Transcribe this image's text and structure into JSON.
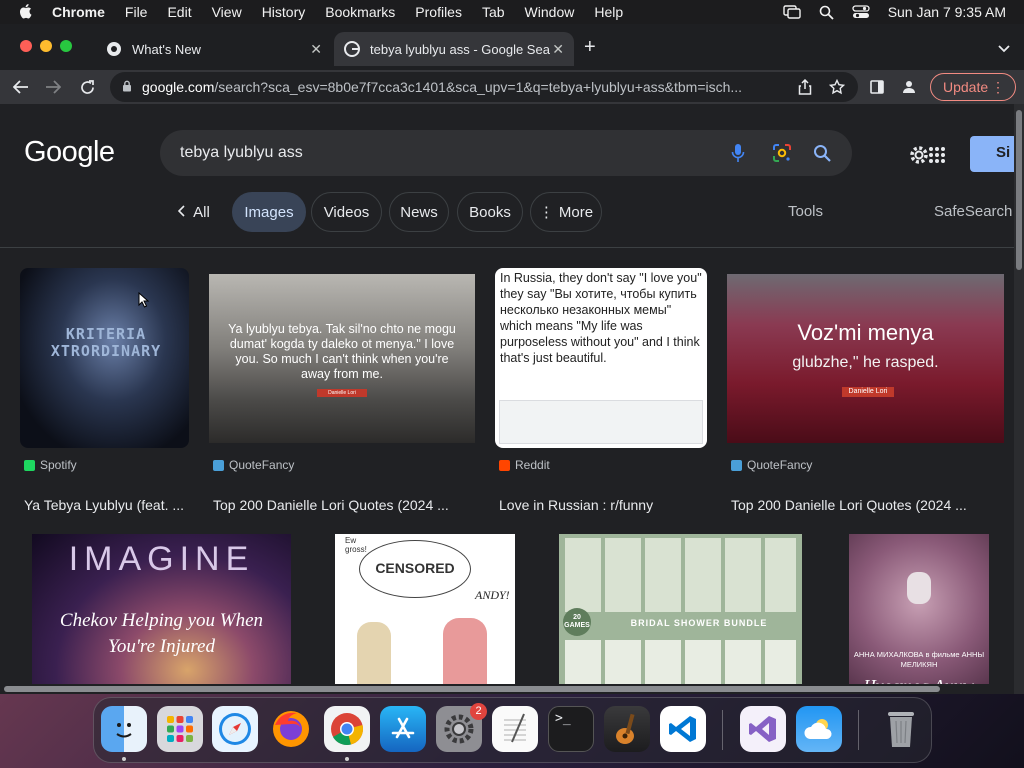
{
  "menubar": {
    "app": "Chrome",
    "items": [
      "File",
      "Edit",
      "View",
      "History",
      "Bookmarks",
      "Profiles",
      "Tab",
      "Window",
      "Help"
    ],
    "datetime": "Sun Jan 7  9:35 AM"
  },
  "tabs": [
    {
      "title": "What's New",
      "active": false
    },
    {
      "title": "tebya lyublyu ass - Google Sea",
      "active": true
    }
  ],
  "address_bar": {
    "host": "google.com",
    "path": "/search?sca_esv=8b0e7f7cca3c1401&sca_upv=1&q=tebya+lyublyu+ass&tbm=isch..."
  },
  "update_button": "Update",
  "google": {
    "logo": "Google",
    "query": "tebya lyublyu ass",
    "signin_label": "Si",
    "chips": [
      "All",
      "Images",
      "Videos",
      "News",
      "Books",
      "More"
    ],
    "active_chip": "Images",
    "tools_label": "Tools",
    "safesearch_label": "SafeSearch"
  },
  "results_row1": [
    {
      "source": "Spotify",
      "title": "Ya Tebya Lyublyu (feat. ...",
      "thumb_text": "KRITERIA XTRORDINARY",
      "icon_color": "#1ed760"
    },
    {
      "source": "QuoteFancy",
      "title": "Top 200 Danielle Lori Quotes (2024 ...",
      "thumb_text": "Ya lyublyu tebya. Tak sil'no chto ne mogu dumat' kogda ty daleko ot menya.\" I love you. So much I can't think when you're away from me.",
      "thumb_caption": "Danielle Lori",
      "icon_color": "#4a9fd8"
    },
    {
      "source": "Reddit",
      "title": "Love in Russian : r/funny",
      "thumb_text": "In Russia, they don't say \"I love you\" they say \"Вы хотите, чтобы купить несколько незаконных мемы\" which means \"My life was purposeless without you\" and I think that's just beautiful.",
      "icon_color": "#ff4500"
    },
    {
      "source": "QuoteFancy",
      "title": "Top 200 Danielle Lori Quotes (2024 ...",
      "thumb_text": "Voz'mi menya",
      "thumb_text2": "glubzhe,\" he rasped.",
      "thumb_caption": "Danielle Lori",
      "icon_color": "#4a9fd8"
    }
  ],
  "results_row2": [
    {
      "thumb_text": "IMAGINE",
      "thumb_text2": "Chekov Helping you When You're Injured"
    },
    {
      "thumb_text": "CENSORED",
      "thumb_text2": "ANDY!",
      "thumb_text3": "Ew gross!"
    },
    {
      "thumb_text": "BRIDAL SHOWER BUNDLE",
      "thumb_text2": "20 GAMES"
    },
    {
      "thumb_text": "АННА МИХАЛКОВА в фильме АННЫ МЕЛИКЯН",
      "thumb_text2": "Чувства Анны"
    }
  ],
  "dock": {
    "apps": [
      "finder-icon",
      "launchpad-icon",
      "safari-icon",
      "firefox-icon",
      "chrome-icon",
      "app-store-icon",
      "system-settings-icon",
      "textedit-icon",
      "terminal-icon",
      "garageband-icon",
      "vscode-icon",
      "visual-studio-icon",
      "weather-icon",
      "trash-icon"
    ],
    "settings_badge": "2",
    "terminal_text": ">_"
  }
}
